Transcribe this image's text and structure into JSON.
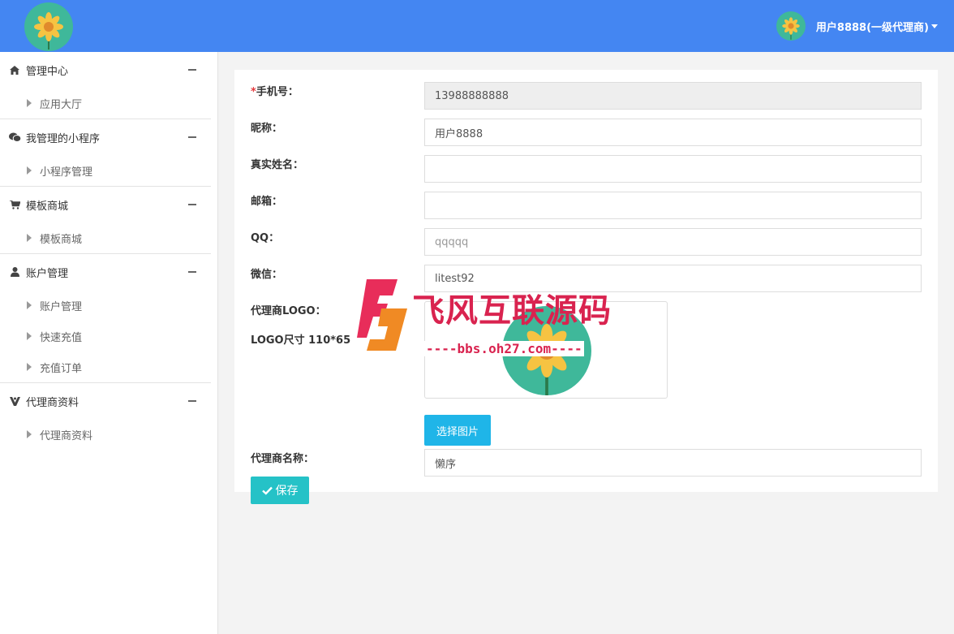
{
  "header": {
    "user_name": "用户8888(一级代理商)"
  },
  "sidebar": {
    "groups": [
      {
        "label": "管理中心",
        "icon": "home-icon",
        "items": [
          {
            "label": "应用大厅"
          }
        ]
      },
      {
        "label": "我管理的小程序",
        "icon": "wechat-icon",
        "items": [
          {
            "label": "小程序管理"
          }
        ]
      },
      {
        "label": "模板商城",
        "icon": "cart-icon",
        "items": [
          {
            "label": "模板商城"
          }
        ]
      },
      {
        "label": "账户管理",
        "icon": "user-icon",
        "items": [
          {
            "label": "账户管理"
          },
          {
            "label": "快速充值"
          },
          {
            "label": "充值订单"
          }
        ]
      },
      {
        "label": "代理商资料",
        "icon": "agent-icon",
        "items": [
          {
            "label": "代理商资料"
          }
        ]
      }
    ]
  },
  "form": {
    "phone": {
      "required_mark": "*",
      "label": "手机号：",
      "value": "13988888888"
    },
    "nickname": {
      "label": "昵称：",
      "value": "用户8888"
    },
    "realname": {
      "label": "真实姓名：",
      "value": ""
    },
    "email": {
      "label": "邮箱：",
      "value": ""
    },
    "qq": {
      "label": "QQ：",
      "placeholder": "qqqqq"
    },
    "wechat": {
      "label": "微信：",
      "value": "litest92"
    },
    "logo": {
      "label": "代理商LOGO：",
      "size_hint": "LOGO尺寸 110*65"
    },
    "pick_image_label": "选择图片",
    "agent_name": {
      "label": "代理商名称：",
      "value": "懒序"
    },
    "save_label": "保存"
  },
  "watermark": {
    "text": "飞风互联源码",
    "url": "----bbs.oh27.com----"
  },
  "colors": {
    "header": "#4486f2",
    "primary_button": "#1fb5e8",
    "save_button": "#25c2c7",
    "logo_bg": "#3fb89a"
  }
}
